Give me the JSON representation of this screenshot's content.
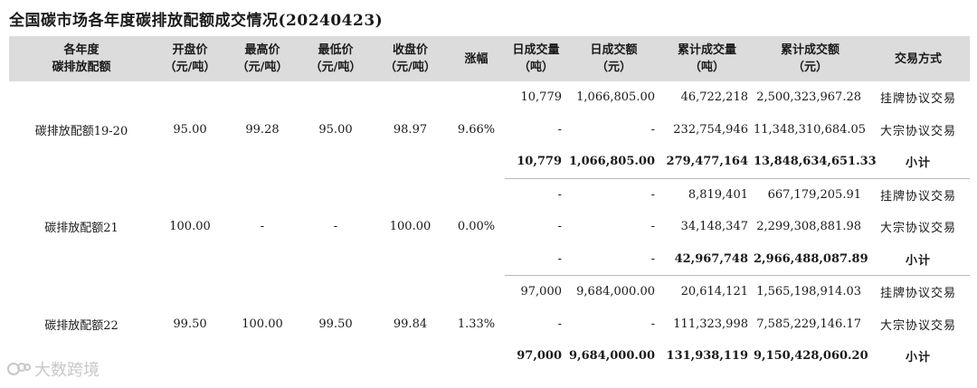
{
  "title": "全国碳市场各年度碳排放配额成交情况(20240423)",
  "headers": [
    [
      "各年度",
      "碳排放配额"
    ],
    [
      "开盘价",
      "（元/吨）"
    ],
    [
      "最高价",
      "（元/吨）"
    ],
    [
      "最低价",
      "（元/吨）"
    ],
    [
      "收盘价",
      "（元/吨）"
    ],
    [
      "涨幅",
      ""
    ],
    [
      "日成交量",
      "（吨）"
    ],
    [
      "日成交额",
      "（元）"
    ],
    [
      "累计成交量",
      "（吨）"
    ],
    [
      "累计成交额",
      "（元）"
    ],
    [
      "交易方式",
      ""
    ]
  ],
  "groups": [
    {
      "name": "碳排放配额19-20",
      "open": "95.00",
      "high": "99.28",
      "low": "95.00",
      "close": "98.97",
      "change": "9.66%",
      "rows": [
        {
          "vol": "10,779",
          "amt": "1,066,805.00",
          "cum_vol": "46,722,218",
          "cum_amt": "2,500,323,967.28",
          "mode": "挂牌协议交易"
        },
        {
          "vol": "-",
          "amt": "-",
          "cum_vol": "232,754,946",
          "cum_amt": "11,348,310,684.05",
          "mode": "大宗协议交易"
        },
        {
          "vol": "10,779",
          "amt": "1,066,805.00",
          "cum_vol": "279,477,164",
          "cum_amt": "13,848,634,651.33",
          "mode": "小计"
        }
      ]
    },
    {
      "name": "碳排放配额21",
      "open": "100.00",
      "high": "-",
      "low": "-",
      "close": "100.00",
      "change": "0.00%",
      "rows": [
        {
          "vol": "-",
          "amt": "-",
          "cum_vol": "8,819,401",
          "cum_amt": "667,179,205.91",
          "mode": "挂牌协议交易"
        },
        {
          "vol": "-",
          "amt": "-",
          "cum_vol": "34,148,347",
          "cum_amt": "2,299,308,881.98",
          "mode": "大宗协议交易"
        },
        {
          "vol": "-",
          "amt": "-",
          "cum_vol": "42,967,748",
          "cum_amt": "2,966,488,087.89",
          "mode": "小计"
        }
      ]
    },
    {
      "name": "碳排放配额22",
      "open": "99.50",
      "high": "100.00",
      "low": "99.50",
      "close": "99.84",
      "change": "1.33%",
      "rows": [
        {
          "vol": "97,000",
          "amt": "9,684,000.00",
          "cum_vol": "20,614,121",
          "cum_amt": "1,565,198,914.03",
          "mode": "挂牌协议交易"
        },
        {
          "vol": "-",
          "amt": "-",
          "cum_vol": "111,323,998",
          "cum_amt": "7,585,229,146.17",
          "mode": "大宗协议交易"
        },
        {
          "vol": "97,000",
          "amt": "9,684,000.00",
          "cum_vol": "131,938,119",
          "cum_amt": "9,150,428,060.20",
          "mode": "小计"
        }
      ]
    }
  ],
  "watermark": "大数跨境",
  "watermark_icon": "brand-logo-icon"
}
